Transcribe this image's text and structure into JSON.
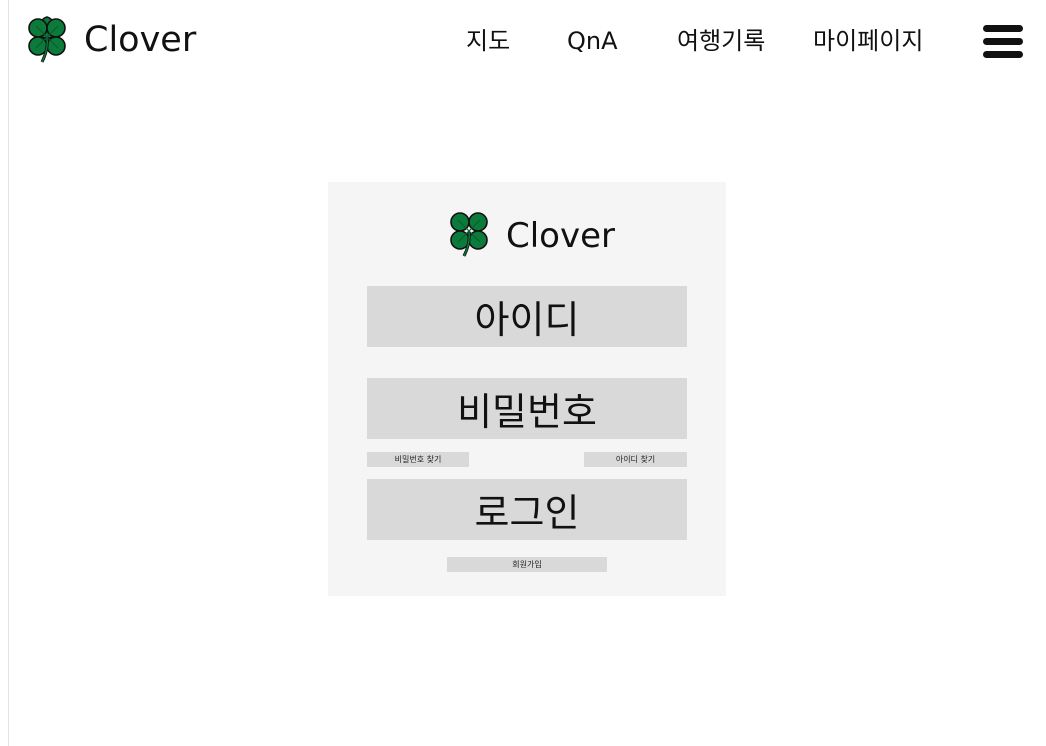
{
  "header": {
    "brand_name": "Clover",
    "brand_icon": "four-leaf-clover-icon",
    "nav": {
      "map": "지도",
      "qna": "QnA",
      "travel_log": "여행기록",
      "mypage": "마이페이지"
    },
    "menu_icon": "hamburger-menu-icon"
  },
  "login": {
    "brand_name": "Clover",
    "brand_icon": "four-leaf-clover-icon",
    "id_field_label": "아이디",
    "password_field_label": "비밀번호",
    "find_password_label": "비밀번호 찾기",
    "find_id_label": "아이디 찾기",
    "login_button_label": "로그인",
    "signup_label": "회원가입"
  },
  "colors": {
    "clover_green": "#0b7a3a",
    "card_background": "#f5f5f5",
    "field_background": "#d9d9d9",
    "text": "#111111"
  }
}
